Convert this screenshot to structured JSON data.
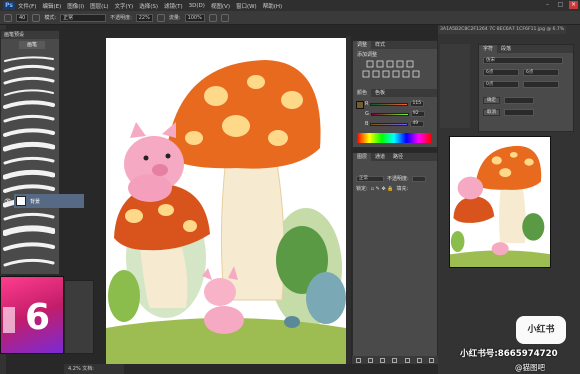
{
  "menubar": {
    "logo": "Ps",
    "items": [
      "文件(F)",
      "编辑(E)",
      "图像(I)",
      "图层(L)",
      "文字(Y)",
      "选择(S)",
      "滤镜(T)",
      "3D(D)",
      "视图(V)",
      "窗口(W)",
      "帮助(H)"
    ]
  },
  "options": {
    "size": "40",
    "mode_label": "模式:",
    "mode_value": "正常",
    "opacity_label": "不透明度:",
    "opacity_value": "22%",
    "flow_label": "流量:",
    "flow_value": "100%"
  },
  "brushes_panel": {
    "header": "画笔预设",
    "tab": "画笔"
  },
  "status": {
    "zoom_docinfo": "4.2% 文档:"
  },
  "color_panel": {
    "tabs": [
      "颜色",
      "色板"
    ],
    "r": "115",
    "g": "92",
    "b": "49",
    "swatch_fg": "#735c31",
    "swatch_bg": "#ffffff"
  },
  "adjust_panel": {
    "tabs": [
      "调整",
      "样式"
    ],
    "title": "添加调整"
  },
  "layers_panel": {
    "tabs": [
      "图层",
      "通道",
      "路径"
    ],
    "blend": "正常",
    "opacity_label": "不透明度:",
    "lock_label": "锁定:",
    "fill_label": "填充:",
    "layer_name": "背景"
  },
  "doc": {
    "title": "3A1A5B2C8C2F1264 7C 8EC6A7 1CF6F11.jpg @ 6.7%"
  },
  "char_panel": {
    "tabs": [
      "字符",
      "段落"
    ],
    "font": "仿宋",
    "size": "6点",
    "leading": "6点",
    "tracking": "0点",
    "button1": "确定",
    "button2": "取消"
  },
  "watermark": {
    "logo": "小红书",
    "id": "小红书号:8665974720",
    "author": "@猫图吧"
  }
}
